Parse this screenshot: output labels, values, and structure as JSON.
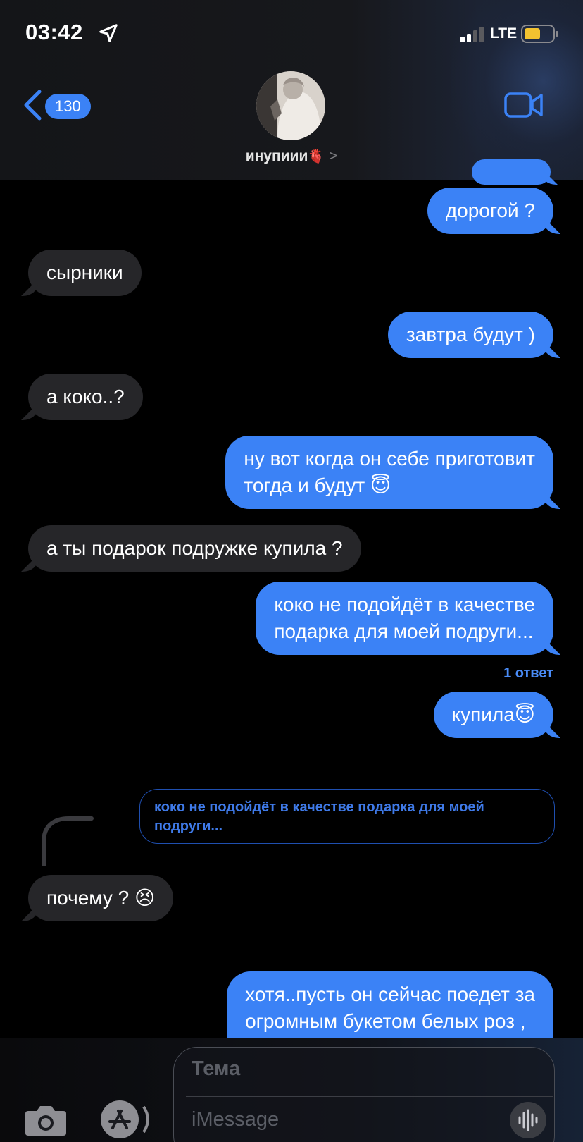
{
  "status_bar": {
    "time": "03:42",
    "network": "LTE",
    "battery_color": "#f2c230"
  },
  "header": {
    "back_count": "130",
    "contact_name": "инупиии",
    "contact_heart": "🫀",
    "chevron": ">",
    "accent_color": "#3b82f6"
  },
  "messages": [
    {
      "side": "out",
      "text": "дорогой ?"
    },
    {
      "side": "in",
      "text": "сырники"
    },
    {
      "side": "out",
      "text": "завтра будут )"
    },
    {
      "side": "in",
      "text": "а коко..?"
    },
    {
      "side": "out",
      "lines": [
        "ну вот когда он себе приготовит",
        "тогда и будут 😇"
      ]
    },
    {
      "side": "in",
      "text": "а ты подарок подружке купила ?"
    },
    {
      "side": "out",
      "lines": [
        "коко не подойдёт в качестве",
        "подарка для моей подруги..."
      ]
    },
    {
      "side": "out",
      "text": "купила😇"
    },
    {
      "side": "in",
      "text": "почему ? 😣"
    },
    {
      "side": "out",
      "lines": [
        "хотя..пусть он сейчас поедет за",
        "огромным букетом белых роз ,"
      ]
    }
  ],
  "reply_count": "1 ответ",
  "quoted_reply": "коко не подойдёт в качестве подарка для моей подруги...",
  "composer": {
    "subject_placeholder": "Тема",
    "message_placeholder": "iMessage"
  }
}
